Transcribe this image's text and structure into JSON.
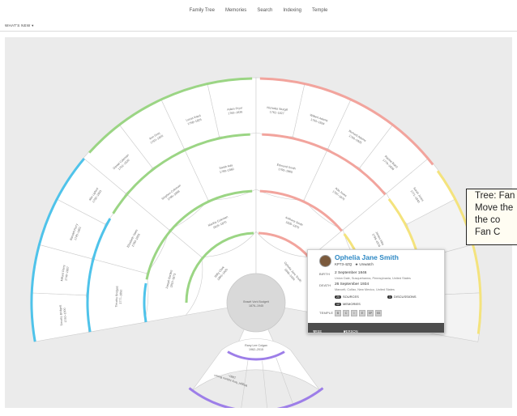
{
  "nav": {
    "items": [
      "Family Tree",
      "Memories",
      "Search",
      "Indexing",
      "Temple"
    ]
  },
  "subbar": {
    "whats_new": "WHAT'S NEW ▾"
  },
  "colors": {
    "green": "#9bd584",
    "red": "#f2a49d",
    "blue": "#4fc3ea",
    "yellow": "#f4e37d",
    "purple": "#9d7ee8",
    "orange": "#f29a3a",
    "wedge_bg": "#ffffff",
    "wedge_border": "#cdcdcd"
  },
  "fan": {
    "root": {
      "name": "Brawit Vork Bodgett",
      "dates": "1876–1945"
    },
    "child": {
      "name": "Rany Lee Colgan",
      "dates": "1962–2015"
    },
    "grandchild": {
      "name": "Wigget Tony Adams Brown",
      "dates": "1980–"
    },
    "gen1": [
      {
        "name": "Willy Clark",
        "dates": "1860–1920"
      },
      {
        "name": "Ophelia Jane Smith",
        "dates": "1846–1934"
      }
    ],
    "gen2": [
      {
        "name": "Joseph Bartlett",
        "dates": "1810–1873"
      },
      {
        "name": "Martha Coleman",
        "dates": "1816–1870"
      },
      {
        "name": "Anthony Smith",
        "dates": "1820–1870"
      },
      {
        "name": "Mary Alba",
        "dates": "1824–1890"
      }
    ],
    "gen3": [
      {
        "name": "Timothy Bridgett",
        "dates": "1777–1850"
      },
      {
        "name": "Elizabeth Yates",
        "dates": "1780–1855"
      },
      {
        "name": "Stephen Coleman",
        "dates": "1785–1858"
      },
      {
        "name": "Sarah Ada",
        "dates": "1790–1860"
      },
      {
        "name": "Edmund Smith",
        "dates": "1795–1865"
      },
      {
        "name": "Ada Jones",
        "dates": "1797–1870"
      },
      {
        "name": "James Alba",
        "dates": "1799–1870"
      },
      {
        "name": "Wilma Cole",
        "dates": "1800–1876"
      }
    ],
    "gen4": [
      {
        "name": "Timothy Bridgett",
        "dates": "1740–1800"
      },
      {
        "name": "Millard Perry",
        "dates": "1740–1807"
      },
      {
        "name": "Bandell Perry",
        "dates": "1745–1801"
      },
      {
        "name": "Abe Lipford",
        "dates": "1750–1803"
      },
      {
        "name": "Daniel Coleman",
        "dates": "1752–1820"
      },
      {
        "name": "Ann Grey",
        "dates": "1755–1820"
      },
      {
        "name": "Lucas Ward",
        "dates": "1758–1825"
      },
      {
        "name": "Adam Pryor",
        "dates": "1760–1826"
      },
      {
        "name": "Nicholas Sturgill",
        "dates": "1762–1827"
      },
      {
        "name": "Wilbert Adams",
        "dates": "1765–1834"
      },
      {
        "name": "Richard Adams",
        "dates": "1766–1835"
      },
      {
        "name": "Rachel Baird",
        "dates": "1770–1838"
      },
      {
        "name": "Sarah Jones",
        "dates": "1771–1840"
      }
    ]
  },
  "popup": {
    "name": "Ophelia Jane Smith",
    "pid": "KP73-4ZQ",
    "status": "★ Unwatch",
    "birth_label": "BIRTH",
    "birth_date": "2 September 1846",
    "birth_place": "Union Dale, Susquehanna, Pennsylvania, United States",
    "death_label": "DEATH",
    "death_date": "26 September 1934",
    "death_place": "Mancelt, Colfax, New Mexico, United States",
    "sources_count": "20",
    "sources_label": "SOURCES",
    "discussions_count": "1",
    "discussions_label": "DISCUSSIONS",
    "memories_count": "12",
    "memories_label": "MEMORIES",
    "temple_label": "TEMPLE",
    "ordinances": [
      "B",
      "C",
      "I",
      "E",
      "SP",
      "SS"
    ],
    "tree_label": "TREE",
    "person_label": "PERSON"
  },
  "callout": {
    "lines": [
      "Tree: Fan C",
      "Move the",
      "the co",
      "Fan C"
    ]
  }
}
